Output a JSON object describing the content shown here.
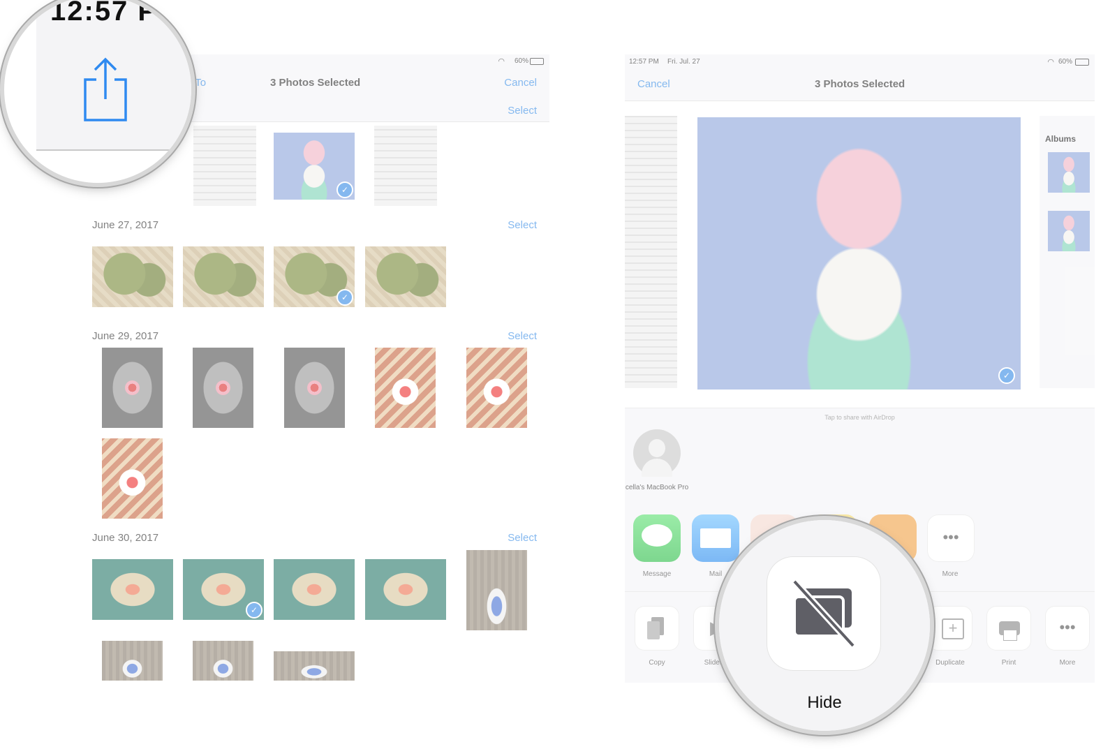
{
  "left": {
    "header": {
      "partial_add": "d To",
      "title": "3 Photos Selected",
      "cancel": "Cancel",
      "battery": "60%",
      "select": "Select"
    },
    "sections": [
      {
        "date": "June 27, 2017",
        "select": "Select"
      },
      {
        "date": "June 29, 2017",
        "select": "Select"
      },
      {
        "date": "June 30, 2017",
        "select": "Select"
      }
    ]
  },
  "magnifier_top": {
    "time": "12:57 P"
  },
  "right": {
    "status": {
      "time": "12:57 PM",
      "date": "Fri. Jul. 27",
      "battery": "60%"
    },
    "header": {
      "cancel": "Cancel",
      "title": "3 Photos Selected"
    },
    "preview_side": {
      "albums": "Albums"
    },
    "airdrop": {
      "hint": "Tap to share with AirDrop",
      "device": "cella's MacBook Pro"
    },
    "share_apps": [
      {
        "label": "Message"
      },
      {
        "label": "Mail"
      },
      {
        "label": "More"
      }
    ],
    "actions": [
      {
        "label": "Copy"
      },
      {
        "label": "Slidesh"
      },
      {
        "label": "Duplicate"
      },
      {
        "label": "Print"
      },
      {
        "label": "More"
      }
    ]
  },
  "magnifier_bottom": {
    "label": "Hide"
  },
  "colors": {
    "accent": "#3a8ee6",
    "message_green": "#3bd05a",
    "mail_blue": "#3a9af6"
  },
  "icons": [
    "share-icon",
    "wifi-icon",
    "battery-icon",
    "checkmark-icon",
    "message-icon",
    "mail-icon",
    "more-icon",
    "copy-icon",
    "slideshow-icon",
    "duplicate-icon",
    "print-icon",
    "hide-icon",
    "person-icon"
  ]
}
